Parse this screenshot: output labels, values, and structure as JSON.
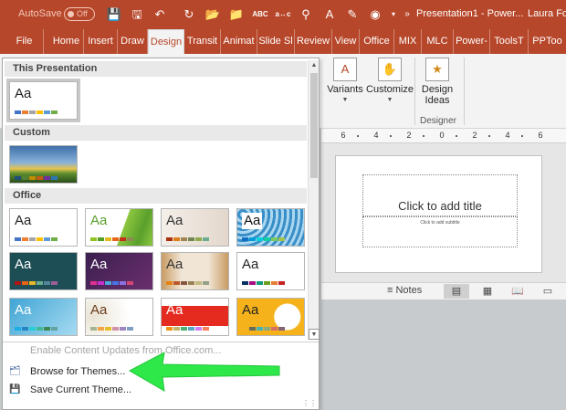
{
  "colors": {
    "accent": "#b7472a",
    "arrow": "#2ee84a"
  },
  "titlebar": {
    "autosave_label": "AutoSave",
    "autosave_state": "Off",
    "title": "Presentation1 - Power...",
    "user": "Laura Fol"
  },
  "tabs": [
    {
      "label": "File"
    },
    {
      "label": "Home"
    },
    {
      "label": "Insert"
    },
    {
      "label": "Draw"
    },
    {
      "label": "Design"
    },
    {
      "label": "Transit"
    },
    {
      "label": "Animat"
    },
    {
      "label": "Slide Sl"
    },
    {
      "label": "Review"
    },
    {
      "label": "View"
    },
    {
      "label": "Office"
    },
    {
      "label": "MIX"
    },
    {
      "label": "MLC"
    },
    {
      "label": "Power-"
    },
    {
      "label": "ToolsT"
    },
    {
      "label": "PPToo"
    }
  ],
  "ribbon": {
    "variants": "Variants",
    "customize": "Customize",
    "design_ideas_1": "Design",
    "design_ideas_2": "Ideas",
    "group_designer": "Designer"
  },
  "ruler": {
    "labels": [
      "6",
      "4",
      "2",
      "0",
      "2",
      "4",
      "6"
    ]
  },
  "slide": {
    "title_placeholder": "Click to add title",
    "subtitle_placeholder": "Click to add subtitle"
  },
  "status": {
    "notes": "Notes"
  },
  "gallery": {
    "sections": {
      "this_presentation": "This Presentation",
      "custom": "Custom",
      "office": "Office"
    },
    "sample_text": "Aa",
    "menu": {
      "enable_updates": "Enable Content Updates from Office.com...",
      "browse": "Browse for Themes...",
      "save": "Save Current Theme..."
    }
  }
}
